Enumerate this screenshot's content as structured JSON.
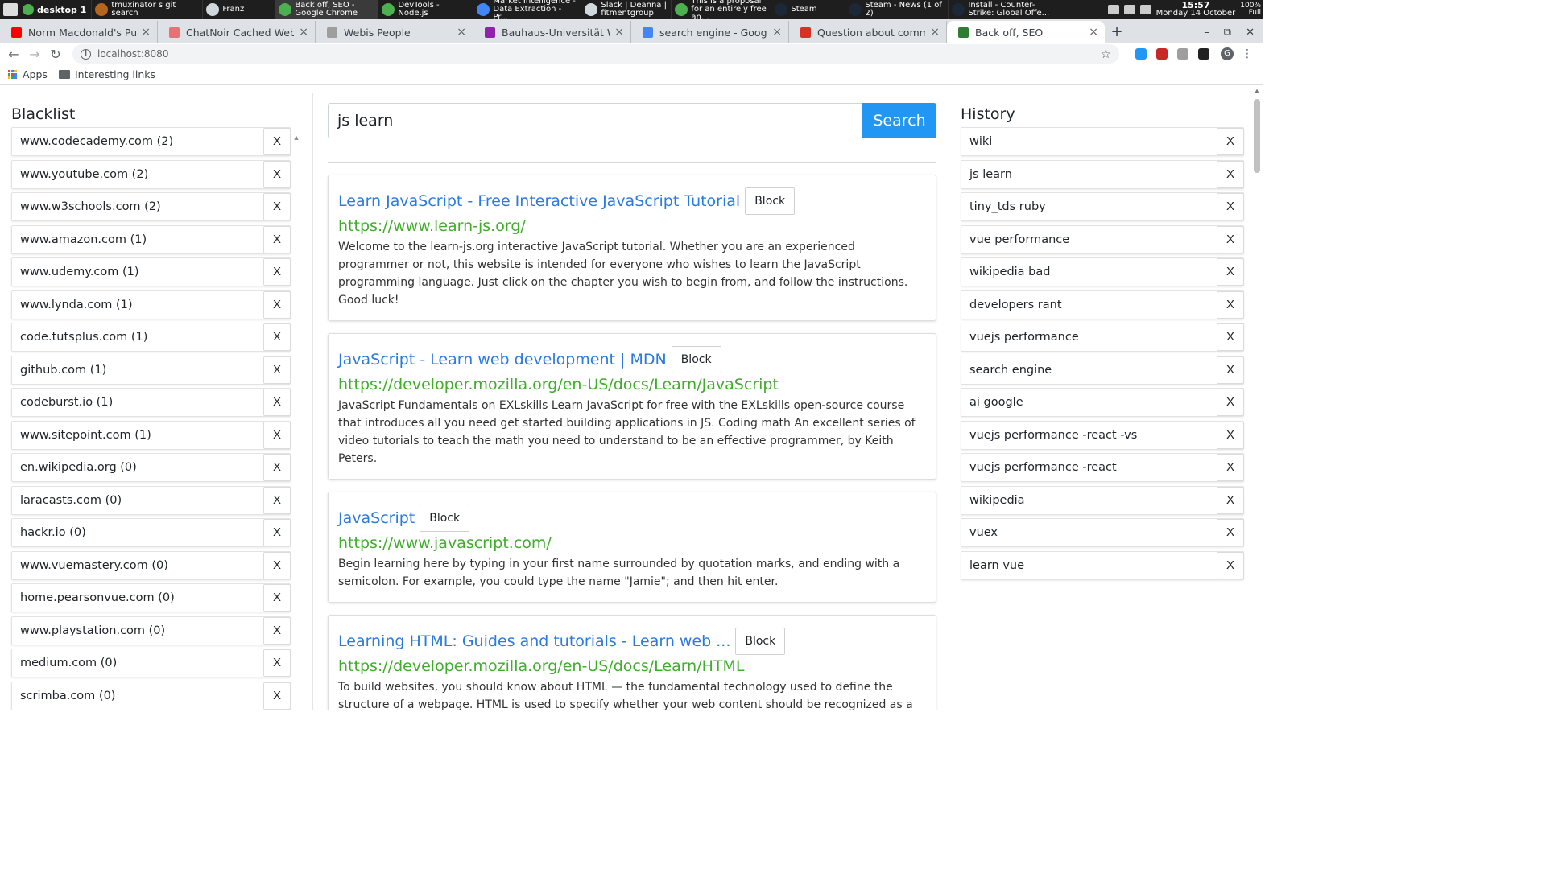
{
  "taskbar": {
    "desktop_label": "desktop 1",
    "tasks": [
      {
        "label": "tmuxinator s git search",
        "icon_color": "#b5651d",
        "active": false
      },
      {
        "label": "Franz",
        "icon_color": "#cfd8dc",
        "active": false
      },
      {
        "label": "Back off, SEO - Google Chrome",
        "icon_color": "#4caf50",
        "active": true
      },
      {
        "label": "DevTools - Node.js",
        "icon_color": "#4caf50",
        "active": false
      },
      {
        "label": "Market Intelligence - Data Extraction - Pr...",
        "icon_color": "#4285f4",
        "active": false
      },
      {
        "label": "Slack | Deanna | fitmentgroup",
        "icon_color": "#cfd8dc",
        "active": false
      },
      {
        "label": "This is a proposal for an entirely free an...",
        "icon_color": "#4caf50",
        "active": false
      },
      {
        "label": "Steam",
        "icon_color": "#1b2838",
        "active": false
      },
      {
        "label": "Steam - News (1 of 2)",
        "icon_color": "#1b2838",
        "active": false
      },
      {
        "label": "Install - Counter-Strike: Global Offe...",
        "icon_color": "#1b2838",
        "active": false
      }
    ],
    "clock_time": "15:57",
    "clock_date": "Monday 14 October",
    "battery_pct": "100%",
    "battery_state": "Full"
  },
  "tabs": [
    {
      "title": "Norm Macdonald's Punni",
      "fav": "#ff0000",
      "active": false
    },
    {
      "title": "ChatNoir Cached Webpag",
      "fav": "#e57373",
      "active": false
    },
    {
      "title": "Webis People",
      "fav": "#9e9e9e",
      "active": false
    },
    {
      "title": "Bauhaus-Universität Wei",
      "fav": "#8e24aa",
      "active": false
    },
    {
      "title": "search engine - Google G",
      "fav": "#4285f4",
      "active": false
    },
    {
      "title": "Question about common c",
      "fav": "#d93025",
      "active": false
    },
    {
      "title": "Back off, SEO",
      "fav": "#2e7d32",
      "active": true
    }
  ],
  "tab_close_glyph": "×",
  "newtab_glyph": "+",
  "window_controls": {
    "minimize": "–",
    "restore": "⧉",
    "close": "✕"
  },
  "toolbar": {
    "url": "localhost:8080",
    "info_glyph": "i",
    "star_glyph": "☆",
    "avatar_letter": "G",
    "menu_glyph": "⋮",
    "extension_colors": [
      "#2196f3",
      "#c62828",
      "#9e9e9e",
      "#212121"
    ]
  },
  "bookmarks": {
    "apps": "Apps",
    "folder": "Interesting links"
  },
  "blacklist": {
    "title": "Blacklist",
    "items": [
      "www.codecademy.com (2)",
      "www.youtube.com (2)",
      "www.w3schools.com (2)",
      "www.amazon.com (1)",
      "www.udemy.com (1)",
      "www.lynda.com (1)",
      "code.tutsplus.com (1)",
      "github.com (1)",
      "codeburst.io (1)",
      "www.sitepoint.com (1)",
      "en.wikipedia.org (0)",
      "laracasts.com (0)",
      "hackr.io (0)",
      "www.vuemastery.com (0)",
      "home.pearsonvue.com (0)",
      "www.playstation.com (0)",
      "medium.com (0)",
      "scrimba.com (0)"
    ],
    "remove_label": "X"
  },
  "search": {
    "value": "js learn",
    "button": "Search"
  },
  "results": [
    {
      "title": "Learn JavaScript - Free Interactive JavaScript Tutorial",
      "url": "https://www.learn-js.org/",
      "desc": "Welcome to the learn-js.org interactive JavaScript tutorial. Whether you are an experienced programmer or not, this website is intended for everyone who wishes to learn the JavaScript programming language. Just click on the chapter you wish to begin from, and follow the instructions. Good luck!"
    },
    {
      "title": "JavaScript - Learn web development | MDN",
      "url": "https://developer.mozilla.org/en-US/docs/Learn/JavaScript",
      "desc": "JavaScript Fundamentals on EXLskills Learn JavaScript for free with the EXLskills open-source course that introduces all you need get started building applications in JS. Coding math An excellent series of video tutorials to teach the math you need to understand to be an effective programmer, by Keith Peters."
    },
    {
      "title": "JavaScript",
      "url": "https://www.javascript.com/",
      "desc": "Begin learning here by typing in your first name surrounded by quotation marks, and ending with a semicolon. For example, you could type the name \"Jamie\"; and then hit enter."
    },
    {
      "title": "Learning HTML: Guides and tutorials - Learn web ...",
      "url": "https://developer.mozilla.org/en-US/docs/Learn/HTML",
      "desc": "To build websites, you should know about HTML — the fundamental technology used to define the structure of a webpage. HTML is used to specify whether your web content should be recognized as a paragraph, list, heading, link, image, multimedia player, form, or one of many other available elements or even a new element that you define."
    }
  ],
  "block_label": "Block",
  "history": {
    "title": "History",
    "items": [
      "wiki",
      "js learn",
      "tiny_tds ruby",
      "vue performance",
      "wikipedia bad",
      "developers rant",
      "vuejs performance",
      "search engine",
      "ai google",
      "vuejs performance -react -vs",
      "vuejs performance -react",
      "wikipedia",
      "vuex",
      "learn vue"
    ],
    "remove_label": "X"
  },
  "scroll_arrow_up": "▲"
}
